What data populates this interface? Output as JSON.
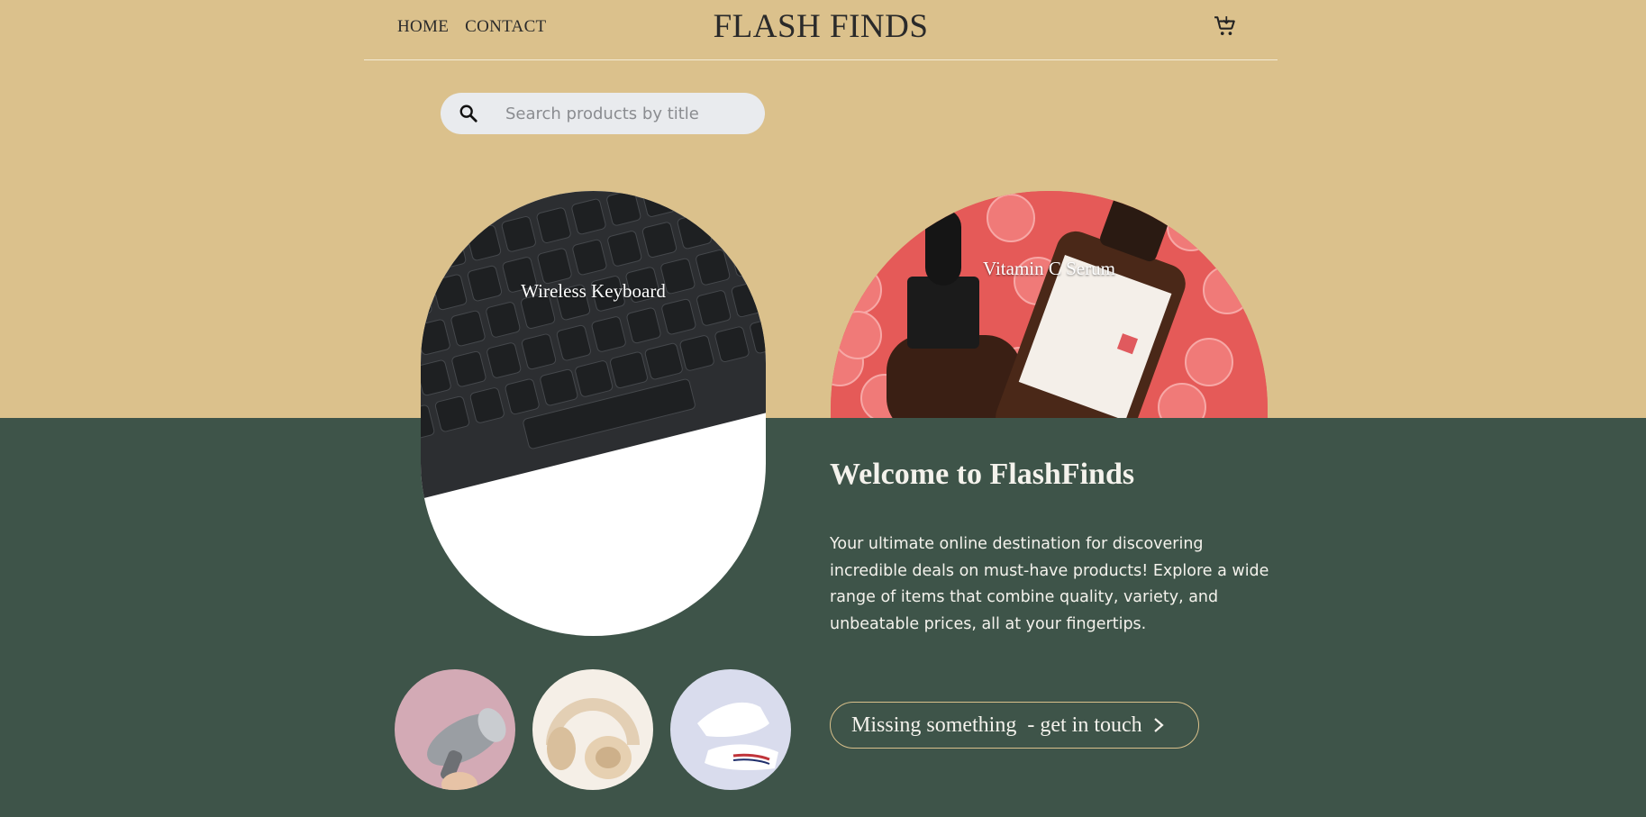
{
  "header": {
    "nav": [
      {
        "label": "HOME"
      },
      {
        "label": "CONTACT"
      }
    ],
    "brand": "FLASH FINDS",
    "cart_icon": "cart-icon"
  },
  "search": {
    "placeholder": "Search products by title",
    "icon": "search-icon"
  },
  "featured": [
    {
      "label": "Wireless Keyboard",
      "image": "keyboard-photo"
    },
    {
      "label": "Vitamin C Serum",
      "image": "serum-photo"
    }
  ],
  "welcome": {
    "title": "Welcome to FlashFinds",
    "body": "Your ultimate online destination for discovering incredible deals on must-have products! Explore a wide range of items that combine quality, variety, and unbeatable prices, all at your fingertips.",
    "cta_label": "Missing something  - get in touch"
  },
  "thumbnails": [
    {
      "image": "hair-dryer-photo"
    },
    {
      "image": "headphones-photo"
    },
    {
      "image": "sneakers-photo"
    }
  ],
  "colors": {
    "top_background": "#dbc18c",
    "bottom_background": "#3e5449",
    "cta_border": "#d9c08b",
    "text_light": "#f4f2ec"
  }
}
